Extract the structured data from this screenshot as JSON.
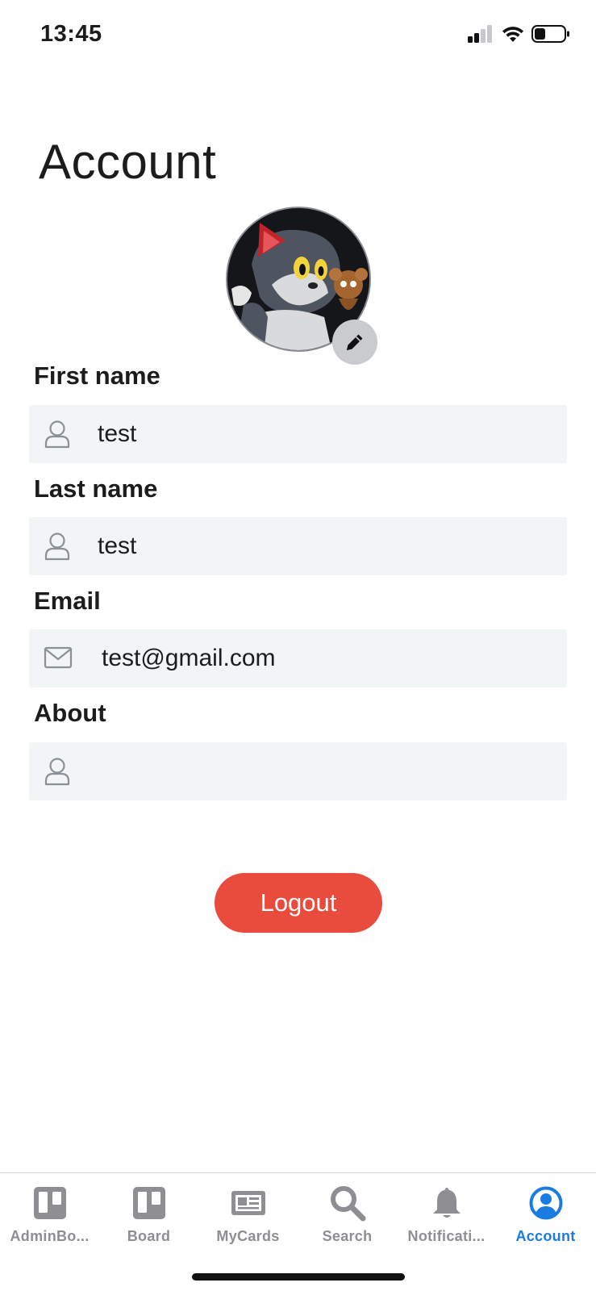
{
  "status_bar": {
    "time": "13:45"
  },
  "page": {
    "title": "Account"
  },
  "fields": [
    {
      "label": "First name",
      "value": "test",
      "icon": "person-icon"
    },
    {
      "label": "Last name",
      "value": "test",
      "icon": "person-icon"
    },
    {
      "label": "Email",
      "value": "test@gmail.com",
      "icon": "mail-icon"
    },
    {
      "label": "About",
      "value": "",
      "icon": "person-icon"
    }
  ],
  "actions": {
    "logout_label": "Logout"
  },
  "tabs": [
    {
      "label": "AdminBo...",
      "icon": "board-icon",
      "active": false
    },
    {
      "label": "Board",
      "icon": "board-icon",
      "active": false
    },
    {
      "label": "MyCards",
      "icon": "cards-icon",
      "active": false
    },
    {
      "label": "Search",
      "icon": "search-icon",
      "active": false
    },
    {
      "label": "Notificati...",
      "icon": "bell-icon",
      "active": false
    },
    {
      "label": "Account",
      "icon": "account-icon",
      "active": true
    }
  ],
  "colors": {
    "accent": "#1a7ce0",
    "logout": "#e94b3c",
    "inactive_tab": "#8e8e93",
    "field_bg": "#f2f5f5"
  }
}
